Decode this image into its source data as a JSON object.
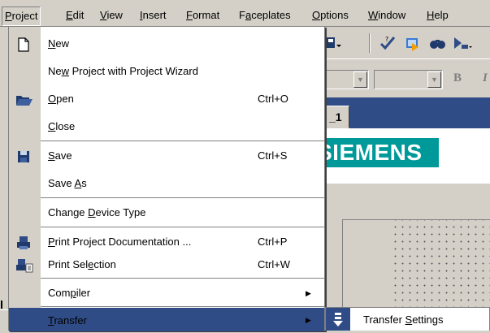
{
  "menubar": [
    {
      "name": "menu-project",
      "pre": "",
      "u": "P",
      "post": "roject",
      "active": true
    },
    {
      "name": "menu-edit",
      "pre": "",
      "u": "E",
      "post": "dit"
    },
    {
      "name": "menu-view",
      "pre": "",
      "u": "V",
      "post": "iew"
    },
    {
      "name": "menu-insert",
      "pre": "",
      "u": "I",
      "post": "nsert"
    },
    {
      "name": "menu-format",
      "pre": "",
      "u": "F",
      "post": "ormat"
    },
    {
      "name": "menu-faceplates",
      "pre": "F",
      "u": "a",
      "post": "ceplates"
    },
    {
      "name": "menu-options",
      "pre": "",
      "u": "O",
      "post": "ptions"
    },
    {
      "name": "menu-window",
      "pre": "",
      "u": "W",
      "post": "indow"
    },
    {
      "name": "menu-help",
      "pre": "",
      "u": "H",
      "post": "elp"
    }
  ],
  "project_menu": {
    "new": {
      "pre": "",
      "u": "N",
      "post": "ew"
    },
    "new_wizard": {
      "pre": "Ne",
      "u": "w",
      "post": " Project with Project Wizard"
    },
    "open": {
      "pre": "",
      "u": "O",
      "post": "pen",
      "shortcut": "Ctrl+O"
    },
    "close": {
      "pre": "",
      "u": "C",
      "post": "lose"
    },
    "save": {
      "pre": "",
      "u": "S",
      "post": "ave",
      "shortcut": "Ctrl+S"
    },
    "save_as": {
      "pre": "Save ",
      "u": "A",
      "post": "s"
    },
    "change_device": {
      "pre": "Change ",
      "u": "D",
      "post": "evice Type"
    },
    "print_doc": {
      "pre": "",
      "u": "P",
      "post": "rint Project Documentation ...",
      "shortcut": "Ctrl+P"
    },
    "print_sel": {
      "pre": "Print Sel",
      "u": "e",
      "post": "ction",
      "shortcut": "Ctrl+W"
    },
    "compiler": {
      "pre": "Com",
      "u": "p",
      "post": "iler"
    },
    "transfer": {
      "pre": "",
      "u": "T",
      "post": "ransfer"
    }
  },
  "transfer_submenu": {
    "transfer_settings": {
      "pre": "Transfer ",
      "u": "S",
      "post": "ettings"
    }
  },
  "document_tab": {
    "label": "_1"
  },
  "brand": {
    "logo_text": "SIEMENS"
  },
  "colors": {
    "highlight": "#2f4c86",
    "siemens_teal": "#009999",
    "face": "#d4d0c8"
  },
  "icons": [
    "new-document-icon",
    "open-folder-icon",
    "save-disk-icon",
    "print-icon",
    "print-selection-icon",
    "transfer-settings-icon",
    "checkmark-icon",
    "submenu-arrow-icon"
  ]
}
